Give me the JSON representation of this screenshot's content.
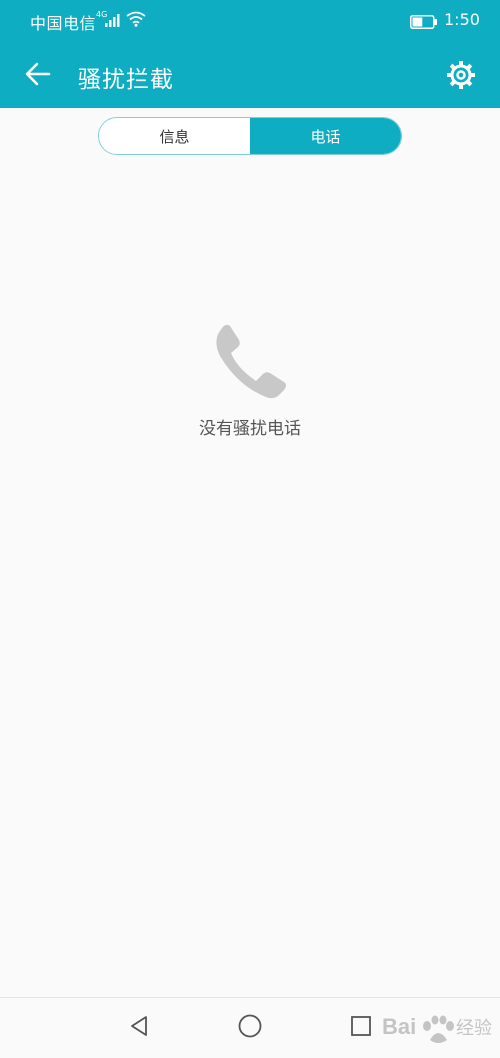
{
  "status_bar": {
    "carrier": "中国电信",
    "network": "4G",
    "time": "1:50",
    "battery_level": 0.5
  },
  "app_bar": {
    "title": "骚扰拦截",
    "back_icon": "arrow-left-icon",
    "settings_icon": "gear-icon"
  },
  "tabs": [
    {
      "label": "信息",
      "selected": false
    },
    {
      "label": "电话",
      "selected": true
    }
  ],
  "empty_state": {
    "icon": "phone-icon",
    "message": "没有骚扰电话"
  },
  "nav_bar": {
    "back_icon": "triangle-back-icon",
    "home_icon": "circle-home-icon",
    "recent_icon": "square-recent-icon"
  },
  "watermark": {
    "text": "Baidu经验"
  },
  "colors": {
    "accent": "#0eadc1",
    "background": "#fafafa",
    "icon_gray": "#c8c8c8",
    "text_secondary": "#555555"
  }
}
